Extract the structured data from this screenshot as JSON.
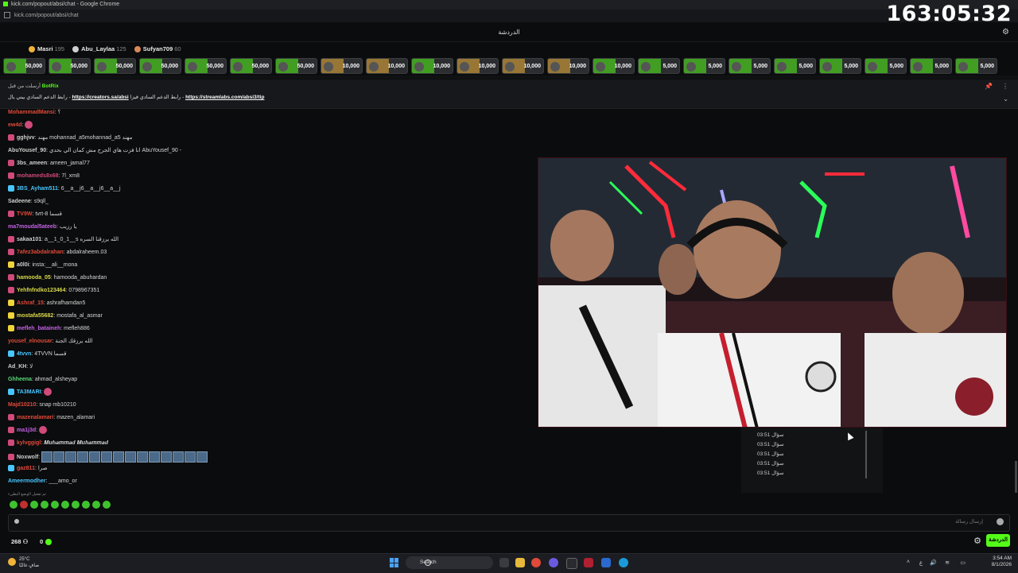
{
  "window": {
    "title": "kick.com/popout/absi/chat - Google Chrome",
    "url": "kick.com/popout/absi/chat"
  },
  "timer": "163:05:32",
  "chat_header": {
    "title": "الدردشة"
  },
  "top_gifters": [
    {
      "name": "Masri",
      "count": "195",
      "color": "#f0b33a"
    },
    {
      "name": "Abu_Laylaa",
      "count": "125",
      "color": "#cfcfcf"
    },
    {
      "name": "Sufyan709",
      "count": "60",
      "color": "#d9885a"
    }
  ],
  "kicks": [
    {
      "amount": "50,000",
      "color": "#53fc18"
    },
    {
      "amount": "50,000",
      "color": "#53fc18"
    },
    {
      "amount": "50,000",
      "color": "#53fc18"
    },
    {
      "amount": "50,000",
      "color": "#53fc18"
    },
    {
      "amount": "50,000",
      "color": "#53fc18"
    },
    {
      "amount": "50,000",
      "color": "#53fc18"
    },
    {
      "amount": "50,000",
      "color": "#53fc18"
    },
    {
      "amount": "10,000",
      "color": "#f0b33a"
    },
    {
      "amount": "10,000",
      "color": "#f0b33a"
    },
    {
      "amount": "10,000",
      "color": "#53fc18"
    },
    {
      "amount": "10,000",
      "color": "#f0b33a"
    },
    {
      "amount": "10,000",
      "color": "#f0b33a"
    },
    {
      "amount": "10,000",
      "color": "#f0b33a"
    },
    {
      "amount": "10,000",
      "color": "#53fc18"
    },
    {
      "amount": "5,000",
      "color": "#53fc18"
    },
    {
      "amount": "5,000",
      "color": "#53fc18"
    },
    {
      "amount": "5,000",
      "color": "#53fc18"
    },
    {
      "amount": "5,000",
      "color": "#53fc18"
    },
    {
      "amount": "5,000",
      "color": "#53fc18"
    },
    {
      "amount": "5,000",
      "color": "#53fc18"
    },
    {
      "amount": "5,000",
      "color": "#53fc18"
    },
    {
      "amount": "5,000",
      "color": "#53fc18"
    }
  ],
  "pinned": {
    "pinned_by": "أرسلت من قبل",
    "bot": "BotRix",
    "text_a": "رابط الدعم السادي بيني يال - ",
    "link_a": "https://creators.sa/absi",
    "text_b": " رابط الدعم السادي فيزا - ",
    "link_b": "https://streamlabs.com/absi3/tip"
  },
  "messages": [
    {
      "user": "MohammadMansi",
      "text": "؟",
      "color": "#e04a3a",
      "badge": ""
    },
    {
      "user": "ew4d",
      "text": "",
      "color": "#e04a3a",
      "badge": "",
      "sticker": true
    },
    {
      "user": "gghjvv",
      "text": "مهند mohannad_a5mohannad_a5 مهند",
      "color": "#cfcfcf",
      "badge": "#d04a7a"
    },
    {
      "user": "AbuYousef_90",
      "text": "انا فزت هاي الجرج مش كمان الي بحدي AbuYousef_90 -",
      "color": "#cfcfcf",
      "badge": ""
    },
    {
      "user": "3bs_ameen",
      "text": "ameen_jamal77",
      "color": "#cfcfcf",
      "badge": "#d04a7a"
    },
    {
      "user": "mohameds8x68",
      "text": "7l_xm8",
      "color": "#d04a7a",
      "badge": "#d04a7a"
    },
    {
      "user": "3BS_Ayham511",
      "text": "6__a__j6__a__j6__a__j",
      "color": "#4ac6ff",
      "badge": "#4ac6ff"
    },
    {
      "user": "Sadeene",
      "text": "s9qll_",
      "color": "#cfcfcf",
      "badge": ""
    },
    {
      "user": "TV9W",
      "text": "tvrt-8 قسما",
      "color": "#e04a3a",
      "badge": "#d04a7a"
    },
    {
      "user": "ma7moudal5ateeb",
      "text": "يا رزيب",
      "color": "#c462e6",
      "badge": ""
    },
    {
      "user": "sakaa101",
      "text": "a__1_0_1__s الله يرزقنا السره",
      "color": "#cfcfcf",
      "badge": "#d04a7a"
    },
    {
      "user": "7afez3abdalrahan",
      "text": "abdalraheem.03",
      "color": "#e04a3a",
      "badge": "#d04a7a"
    },
    {
      "user": "a0l0i",
      "text": "insta:__ali__mona",
      "color": "#cfcfcf",
      "badge": "#f0d43a"
    },
    {
      "user": "hamooda_05",
      "text": "hamooda_abuhardan",
      "color": "#d9d94a",
      "badge": "#d04a7a"
    },
    {
      "user": "Yehfnfndko123464",
      "text": "0798967351",
      "color": "#d9d94a",
      "badge": "#d04a7a"
    },
    {
      "user": "Ashraf_15",
      "text": "ashrafhamdan5",
      "color": "#e04a3a",
      "badge": "#f0d43a"
    },
    {
      "user": "mostafa55682",
      "text": "mostafa_al_asmar",
      "color": "#d9d94a",
      "badge": "#f0d43a"
    },
    {
      "user": "mefleh_bataineh",
      "text": "mefleh886",
      "color": "#c462e6",
      "badge": "#f0d43a"
    },
    {
      "user": "yousef_elnousar",
      "text": "الله يرزقك الجنة",
      "color": "#e04a3a",
      "badge": ""
    },
    {
      "user": "4tvvn",
      "text": "4TVVN قسما",
      "color": "#4ac6ff",
      "badge": "#4ac6ff"
    },
    {
      "user": "Ad_KH",
      "text": "لا",
      "color": "#cfcfcf",
      "badge": ""
    },
    {
      "user": "Ghheena",
      "text": "ahmad_alsheyap",
      "color": "#5ad97a",
      "badge": ""
    },
    {
      "user": "TA3MARI",
      "text": "",
      "color": "#4ac6ff",
      "badge": "#4ac6ff",
      "sticker": true
    },
    {
      "user": "Majd10210",
      "text": "snap mb10210",
      "color": "#e04a3a",
      "badge": ""
    },
    {
      "user": "mazenalamari",
      "text": "mazen_alamari",
      "color": "#e04a3a",
      "badge": "#d04a7a"
    },
    {
      "user": "ma1j3d",
      "text": "",
      "color": "#c462e6",
      "badge": "#d04a7a",
      "sticker": true
    },
    {
      "user": "kylvggigl",
      "text": "𝑴𝒖𝒉𝒂𝒎𝒎𝒂𝒅 𝑴𝒖𝒉𝒂𝒎𝒎𝒂𝒅",
      "color": "#e04a3a",
      "badge": "#d04a7a"
    },
    {
      "user": "Noxwolf",
      "text": "",
      "color": "#cfcfcf",
      "badge": "#d04a7a",
      "emotes": 14
    },
    {
      "user": "gaz811",
      "text": "صرا",
      "color": "#e04a3a",
      "badge": "#4ac6ff"
    },
    {
      "user": "Ameermodher",
      "text": "___amo_or",
      "color": "#4ac6ff",
      "badge": ""
    }
  ],
  "typing_hint": "تم تفعيل الوضع البطيء",
  "input": {
    "placeholder": "إرسال رسالة"
  },
  "footer": {
    "viewers": "268",
    "points": "0",
    "chat_button": "الدردشة"
  },
  "history": [
    {
      "time": "03:51",
      "label": "سؤال"
    },
    {
      "time": "03:51",
      "label": "سؤال"
    },
    {
      "time": "03:51",
      "label": "سؤال"
    },
    {
      "time": "03:51",
      "label": "سؤال"
    },
    {
      "time": "03:51",
      "label": "سؤال"
    }
  ],
  "taskbar": {
    "weather_temp": "25°C",
    "weather_desc": "صافٍ غالبًا",
    "search": "Search",
    "time": "3:54 AM",
    "date": "8/1/2026"
  }
}
